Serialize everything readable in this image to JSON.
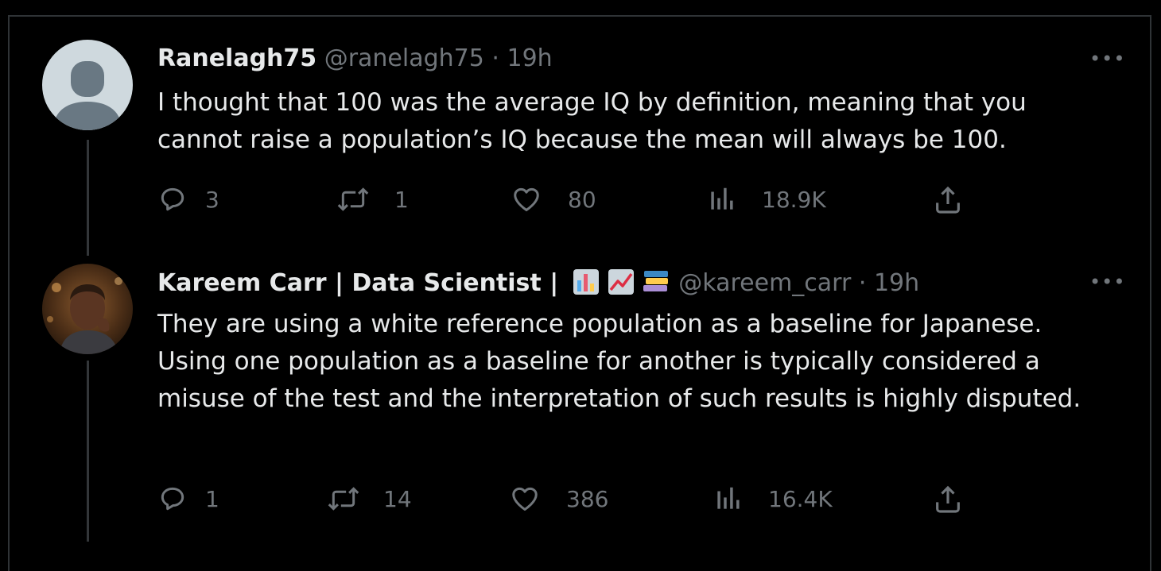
{
  "tweets": [
    {
      "name": "Ranelagh75",
      "handle": "@ranelagh75",
      "separator": "·",
      "time": "19h",
      "body": "I thought that 100 was the average IQ by definition, meaning that you cannot raise a population’s IQ because the mean will always be 100.",
      "more": "•••",
      "replies": "3",
      "reposts": "1",
      "likes": "80",
      "views": "18.9K",
      "avatar": "default-avatar-icon"
    },
    {
      "name": "Kareem Carr | Data Scientist |",
      "handle": "@kareem_carr",
      "separator": "·",
      "time": "19h",
      "body": "They are using a white reference population as a baseline for Japanese. Using one population as a baseline for another is typically considered a misuse of the test and the interpretation of such results is highly disputed.",
      "more": "•••",
      "replies": "1",
      "reposts": "14",
      "likes": "386",
      "views": "16.4K",
      "name_emojis": [
        "bar-chart-emoji",
        "chart-increasing-emoji",
        "books-emoji"
      ],
      "avatar": "profile-photo"
    }
  ],
  "colors": {
    "background": "#000000",
    "text": "#e7e9ea",
    "secondary": "#71767b",
    "border": "#2f3336"
  }
}
